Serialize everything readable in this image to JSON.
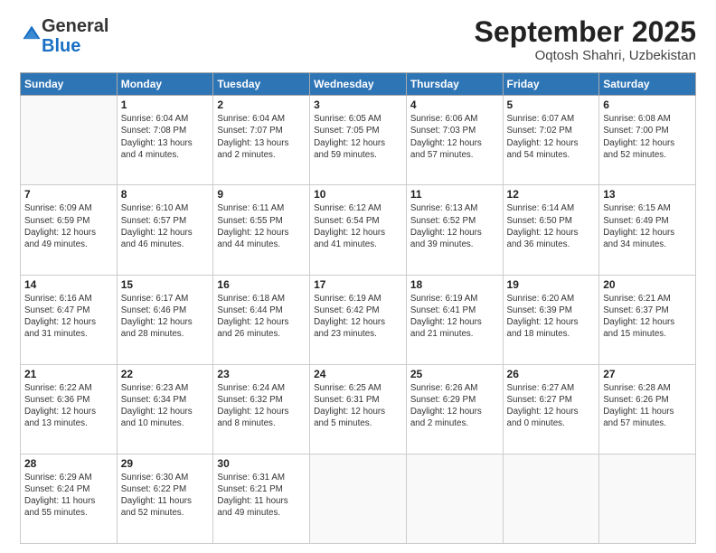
{
  "header": {
    "logo_general": "General",
    "logo_blue": "Blue",
    "title": "September 2025",
    "location": "Oqtosh Shahri, Uzbekistan"
  },
  "days_of_week": [
    "Sunday",
    "Monday",
    "Tuesday",
    "Wednesday",
    "Thursday",
    "Friday",
    "Saturday"
  ],
  "weeks": [
    [
      {
        "day": "",
        "info": ""
      },
      {
        "day": "1",
        "info": "Sunrise: 6:04 AM\nSunset: 7:08 PM\nDaylight: 13 hours\nand 4 minutes."
      },
      {
        "day": "2",
        "info": "Sunrise: 6:04 AM\nSunset: 7:07 PM\nDaylight: 13 hours\nand 2 minutes."
      },
      {
        "day": "3",
        "info": "Sunrise: 6:05 AM\nSunset: 7:05 PM\nDaylight: 12 hours\nand 59 minutes."
      },
      {
        "day": "4",
        "info": "Sunrise: 6:06 AM\nSunset: 7:03 PM\nDaylight: 12 hours\nand 57 minutes."
      },
      {
        "day": "5",
        "info": "Sunrise: 6:07 AM\nSunset: 7:02 PM\nDaylight: 12 hours\nand 54 minutes."
      },
      {
        "day": "6",
        "info": "Sunrise: 6:08 AM\nSunset: 7:00 PM\nDaylight: 12 hours\nand 52 minutes."
      }
    ],
    [
      {
        "day": "7",
        "info": "Sunrise: 6:09 AM\nSunset: 6:59 PM\nDaylight: 12 hours\nand 49 minutes."
      },
      {
        "day": "8",
        "info": "Sunrise: 6:10 AM\nSunset: 6:57 PM\nDaylight: 12 hours\nand 46 minutes."
      },
      {
        "day": "9",
        "info": "Sunrise: 6:11 AM\nSunset: 6:55 PM\nDaylight: 12 hours\nand 44 minutes."
      },
      {
        "day": "10",
        "info": "Sunrise: 6:12 AM\nSunset: 6:54 PM\nDaylight: 12 hours\nand 41 minutes."
      },
      {
        "day": "11",
        "info": "Sunrise: 6:13 AM\nSunset: 6:52 PM\nDaylight: 12 hours\nand 39 minutes."
      },
      {
        "day": "12",
        "info": "Sunrise: 6:14 AM\nSunset: 6:50 PM\nDaylight: 12 hours\nand 36 minutes."
      },
      {
        "day": "13",
        "info": "Sunrise: 6:15 AM\nSunset: 6:49 PM\nDaylight: 12 hours\nand 34 minutes."
      }
    ],
    [
      {
        "day": "14",
        "info": "Sunrise: 6:16 AM\nSunset: 6:47 PM\nDaylight: 12 hours\nand 31 minutes."
      },
      {
        "day": "15",
        "info": "Sunrise: 6:17 AM\nSunset: 6:46 PM\nDaylight: 12 hours\nand 28 minutes."
      },
      {
        "day": "16",
        "info": "Sunrise: 6:18 AM\nSunset: 6:44 PM\nDaylight: 12 hours\nand 26 minutes."
      },
      {
        "day": "17",
        "info": "Sunrise: 6:19 AM\nSunset: 6:42 PM\nDaylight: 12 hours\nand 23 minutes."
      },
      {
        "day": "18",
        "info": "Sunrise: 6:19 AM\nSunset: 6:41 PM\nDaylight: 12 hours\nand 21 minutes."
      },
      {
        "day": "19",
        "info": "Sunrise: 6:20 AM\nSunset: 6:39 PM\nDaylight: 12 hours\nand 18 minutes."
      },
      {
        "day": "20",
        "info": "Sunrise: 6:21 AM\nSunset: 6:37 PM\nDaylight: 12 hours\nand 15 minutes."
      }
    ],
    [
      {
        "day": "21",
        "info": "Sunrise: 6:22 AM\nSunset: 6:36 PM\nDaylight: 12 hours\nand 13 minutes."
      },
      {
        "day": "22",
        "info": "Sunrise: 6:23 AM\nSunset: 6:34 PM\nDaylight: 12 hours\nand 10 minutes."
      },
      {
        "day": "23",
        "info": "Sunrise: 6:24 AM\nSunset: 6:32 PM\nDaylight: 12 hours\nand 8 minutes."
      },
      {
        "day": "24",
        "info": "Sunrise: 6:25 AM\nSunset: 6:31 PM\nDaylight: 12 hours\nand 5 minutes."
      },
      {
        "day": "25",
        "info": "Sunrise: 6:26 AM\nSunset: 6:29 PM\nDaylight: 12 hours\nand 2 minutes."
      },
      {
        "day": "26",
        "info": "Sunrise: 6:27 AM\nSunset: 6:27 PM\nDaylight: 12 hours\nand 0 minutes."
      },
      {
        "day": "27",
        "info": "Sunrise: 6:28 AM\nSunset: 6:26 PM\nDaylight: 11 hours\nand 57 minutes."
      }
    ],
    [
      {
        "day": "28",
        "info": "Sunrise: 6:29 AM\nSunset: 6:24 PM\nDaylight: 11 hours\nand 55 minutes."
      },
      {
        "day": "29",
        "info": "Sunrise: 6:30 AM\nSunset: 6:22 PM\nDaylight: 11 hours\nand 52 minutes."
      },
      {
        "day": "30",
        "info": "Sunrise: 6:31 AM\nSunset: 6:21 PM\nDaylight: 11 hours\nand 49 minutes."
      },
      {
        "day": "",
        "info": ""
      },
      {
        "day": "",
        "info": ""
      },
      {
        "day": "",
        "info": ""
      },
      {
        "day": "",
        "info": ""
      }
    ]
  ]
}
